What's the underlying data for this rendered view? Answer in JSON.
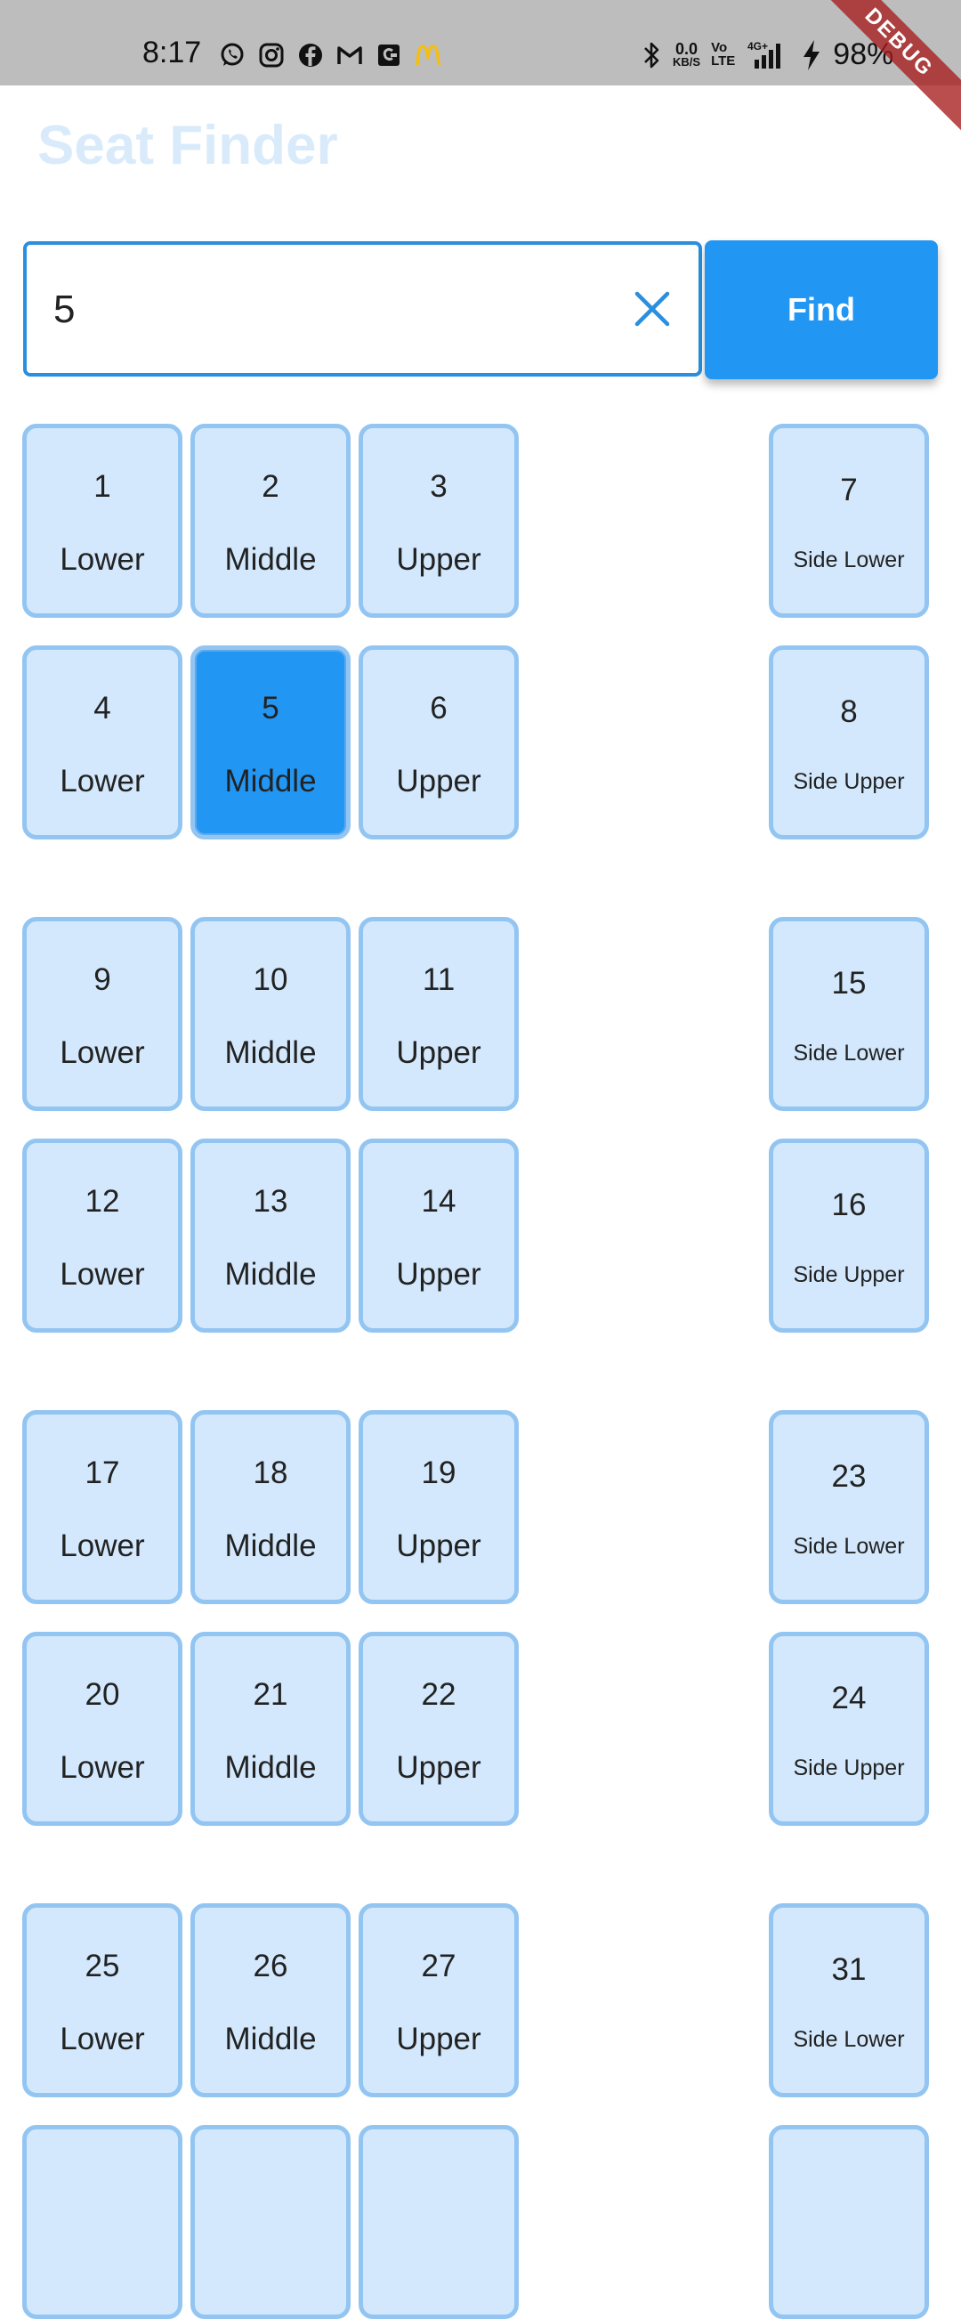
{
  "status_bar": {
    "time": "8:17",
    "left_icons": [
      "whatsapp-icon",
      "instagram-icon",
      "facebook-icon",
      "gmail-icon",
      "app-icon",
      "mcdonalds-icon"
    ],
    "net_speed_value": "0.0",
    "net_speed_unit": "KB/S",
    "volte_top": "Vo",
    "volte_bottom": "LTE",
    "network_label": "4G+",
    "battery": "98%"
  },
  "debug_banner": "DEBUG",
  "app": {
    "title": "Seat Finder",
    "title_color": "#d9ebfb",
    "accent_color": "#2196f3"
  },
  "search": {
    "value": "5",
    "placeholder": "",
    "find_label": "Find"
  },
  "seats": [
    {
      "number": "1",
      "type": "Lower",
      "side": false,
      "selected": false
    },
    {
      "number": "2",
      "type": "Middle",
      "side": false,
      "selected": false
    },
    {
      "number": "3",
      "type": "Upper",
      "side": false,
      "selected": false
    },
    {
      "number": "7",
      "type": "Side Lower",
      "side": true,
      "selected": false
    },
    {
      "number": "4",
      "type": "Lower",
      "side": false,
      "selected": false
    },
    {
      "number": "5",
      "type": "Middle",
      "side": false,
      "selected": true
    },
    {
      "number": "6",
      "type": "Upper",
      "side": false,
      "selected": false
    },
    {
      "number": "8",
      "type": "Side Upper",
      "side": true,
      "selected": false
    },
    {
      "number": "9",
      "type": "Lower",
      "side": false,
      "selected": false
    },
    {
      "number": "10",
      "type": "Middle",
      "side": false,
      "selected": false
    },
    {
      "number": "11",
      "type": "Upper",
      "side": false,
      "selected": false
    },
    {
      "number": "15",
      "type": "Side Lower",
      "side": true,
      "selected": false
    },
    {
      "number": "12",
      "type": "Lower",
      "side": false,
      "selected": false
    },
    {
      "number": "13",
      "type": "Middle",
      "side": false,
      "selected": false
    },
    {
      "number": "14",
      "type": "Upper",
      "side": false,
      "selected": false
    },
    {
      "number": "16",
      "type": "Side Upper",
      "side": true,
      "selected": false
    },
    {
      "number": "17",
      "type": "Lower",
      "side": false,
      "selected": false
    },
    {
      "number": "18",
      "type": "Middle",
      "side": false,
      "selected": false
    },
    {
      "number": "19",
      "type": "Upper",
      "side": false,
      "selected": false
    },
    {
      "number": "23",
      "type": "Side Lower",
      "side": true,
      "selected": false
    },
    {
      "number": "20",
      "type": "Lower",
      "side": false,
      "selected": false
    },
    {
      "number": "21",
      "type": "Middle",
      "side": false,
      "selected": false
    },
    {
      "number": "22",
      "type": "Upper",
      "side": false,
      "selected": false
    },
    {
      "number": "24",
      "type": "Side Upper",
      "side": true,
      "selected": false
    },
    {
      "number": "25",
      "type": "Lower",
      "side": false,
      "selected": false
    },
    {
      "number": "26",
      "type": "Middle",
      "side": false,
      "selected": false
    },
    {
      "number": "27",
      "type": "Upper",
      "side": false,
      "selected": false
    },
    {
      "number": "31",
      "type": "Side Lower",
      "side": true,
      "selected": false
    },
    {
      "number": "",
      "type": "",
      "side": false,
      "selected": false
    },
    {
      "number": "",
      "type": "",
      "side": false,
      "selected": false
    },
    {
      "number": "",
      "type": "",
      "side": false,
      "selected": false
    },
    {
      "number": "",
      "type": "",
      "side": true,
      "selected": false
    }
  ]
}
